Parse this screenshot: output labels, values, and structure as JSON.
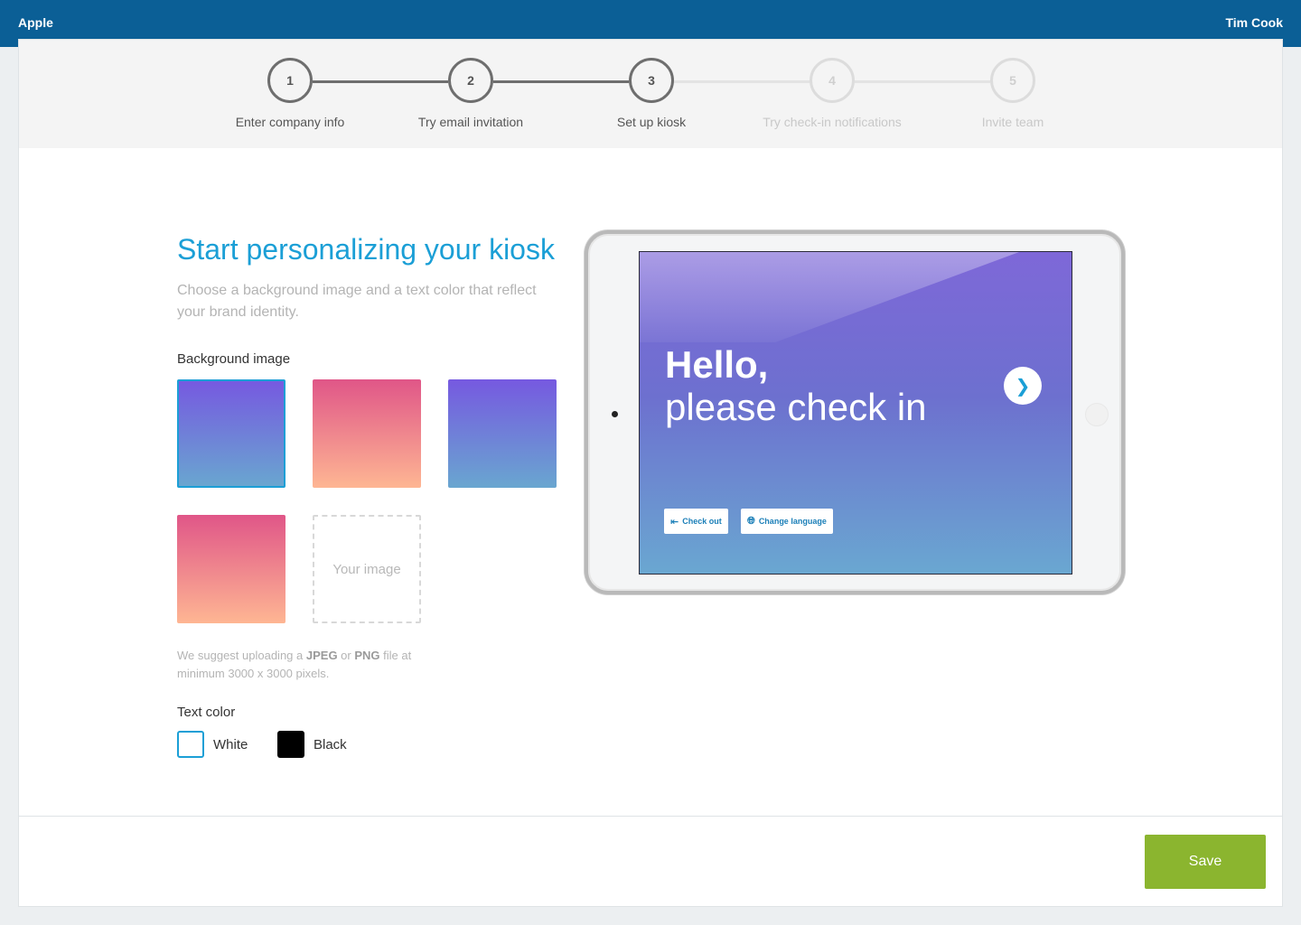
{
  "header": {
    "brand": "Apple",
    "user": "Tim Cook"
  },
  "steps": [
    {
      "number": "1",
      "label": "Enter company info",
      "state": "done"
    },
    {
      "number": "2",
      "label": "Try email invitation",
      "state": "done"
    },
    {
      "number": "3",
      "label": "Set up kiosk",
      "state": "current"
    },
    {
      "number": "4",
      "label": "Try check-in notifications",
      "state": "inactive"
    },
    {
      "number": "5",
      "label": "Invite team",
      "state": "inactive"
    }
  ],
  "main": {
    "title": "Start personalizing your kiosk",
    "subtitle": "Choose a background image and a text color that reflect your brand identity.",
    "background_label": "Background image",
    "swatches": [
      {
        "name": "purple-blue",
        "colors": [
          "#7659e0",
          "#69a6d0"
        ],
        "selected": true
      },
      {
        "name": "pink-peach",
        "colors": [
          "#e05688",
          "#feb693"
        ],
        "selected": false
      },
      {
        "name": "purple-blue",
        "colors": [
          "#7659e0",
          "#69a6d0"
        ],
        "selected": false
      },
      {
        "name": "pink-peach",
        "colors": [
          "#e05688",
          "#feb693"
        ],
        "selected": false
      }
    ],
    "upload_label": "Your image",
    "hint": {
      "prefix": "We suggest uploading a ",
      "fmt1": "JPEG",
      "or": " or ",
      "fmt2": "PNG",
      "suffix": " file at minimum 3000 x 3000 pixels."
    },
    "text_color_label": "Text color",
    "text_colors": [
      {
        "label": "White",
        "selected": true
      },
      {
        "label": "Black",
        "selected": false
      }
    ]
  },
  "preview": {
    "hello": "Hello,",
    "please": "please check in",
    "checkout": "Check out",
    "change_language": "Change language"
  },
  "footer": {
    "save_label": "Save"
  },
  "colors": {
    "header": "#0b5f96",
    "accent": "#1b9fd6",
    "save": "#8bb52f",
    "step_done": "#6e6e6e",
    "step_inactive": "#dcdcdc"
  }
}
